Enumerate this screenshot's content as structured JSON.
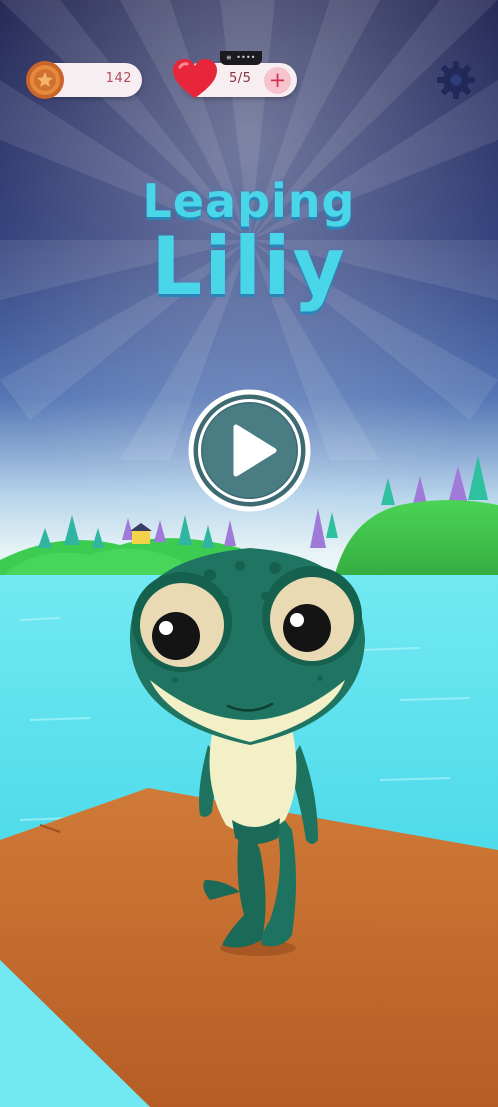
{
  "hud": {
    "coins": "142",
    "lives": "5/5",
    "plus_label": "+",
    "notch_tag": "≡ ••••"
  },
  "title": {
    "line1": "Leaping",
    "line2": "Liliy"
  },
  "icons": {
    "coin": "coin-star-icon",
    "heart": "heart-icon",
    "settings": "gear-icon",
    "play": "play-icon"
  },
  "colors": {
    "title": "#49d6e8",
    "title_shadow": "#2a86b8",
    "pill_bg": "#f7eef2",
    "heart": "#e8263a",
    "coin": "#e0823c",
    "water": "#5fe2ee",
    "dock": "#c46a2e",
    "frog": "#1f6e5c"
  }
}
